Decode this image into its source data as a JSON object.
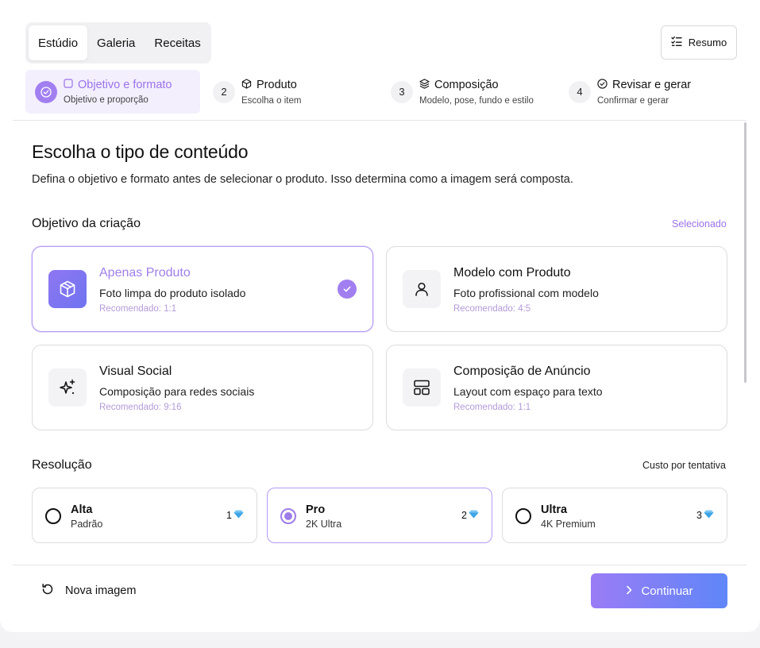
{
  "tabs": [
    {
      "label": "Estúdio",
      "active": true
    },
    {
      "label": "Galeria",
      "active": false
    },
    {
      "label": "Receitas",
      "active": false
    }
  ],
  "resumo_label": "Resumo",
  "steps": [
    {
      "number": "1",
      "title": "Objetivo e formato",
      "subtitle": "Objetivo e proporção",
      "icon": "square-icon",
      "state": "active"
    },
    {
      "number": "2",
      "title": "Produto",
      "subtitle": "Escolha o item",
      "icon": "box-icon"
    },
    {
      "number": "3",
      "title": "Composição",
      "subtitle": "Modelo, pose, fundo e estilo",
      "icon": "layers-icon"
    },
    {
      "number": "4",
      "title": "Revisar e gerar",
      "subtitle": "Confirmar e gerar",
      "icon": "check-circle-icon"
    }
  ],
  "main": {
    "title": "Escolha o tipo de conteúdo",
    "lead": "Defina o objetivo e formato antes de selecionar o produto. Isso determina como a imagem será composta."
  },
  "objective": {
    "title": "Objetivo da criação",
    "note": "Selecionado",
    "cards": [
      {
        "title": "Apenas Produto",
        "desc": "Foto limpa do produto isolado",
        "rec": "Recomendado: 1:1",
        "icon": "box-icon",
        "selected": true
      },
      {
        "title": "Modelo com Produto",
        "desc": "Foto profissional com modelo",
        "rec": "Recomendado: 4:5",
        "icon": "user-icon",
        "selected": false
      },
      {
        "title": "Visual Social",
        "desc": "Composição para redes sociais",
        "rec": "Recomendado: 9:16",
        "icon": "sparkles-icon",
        "selected": false
      },
      {
        "title": "Composição de Anúncio",
        "desc": "Layout com espaço para texto",
        "rec": "Recomendado: 1:1",
        "icon": "layout-icon",
        "selected": false
      }
    ]
  },
  "resolution": {
    "title": "Resolução",
    "note": "Custo por tentativa",
    "options": [
      {
        "title": "Alta",
        "sub": "Padrão",
        "cost": "1",
        "selected": false
      },
      {
        "title": "Pro",
        "sub": "2K Ultra",
        "cost": "2",
        "selected": true
      },
      {
        "title": "Ultra",
        "sub": "4K Premium",
        "cost": "3",
        "selected": false
      }
    ],
    "cost_icon": "diamond-icon"
  },
  "footer": {
    "new_label": "Nova imagem",
    "continue_label": "Continuar"
  },
  "colors": {
    "accent": "#9b72ea",
    "accent_light": "#f3effd",
    "button_gradient_start": "#9a7cf6",
    "button_gradient_end": "#5f86f7"
  }
}
